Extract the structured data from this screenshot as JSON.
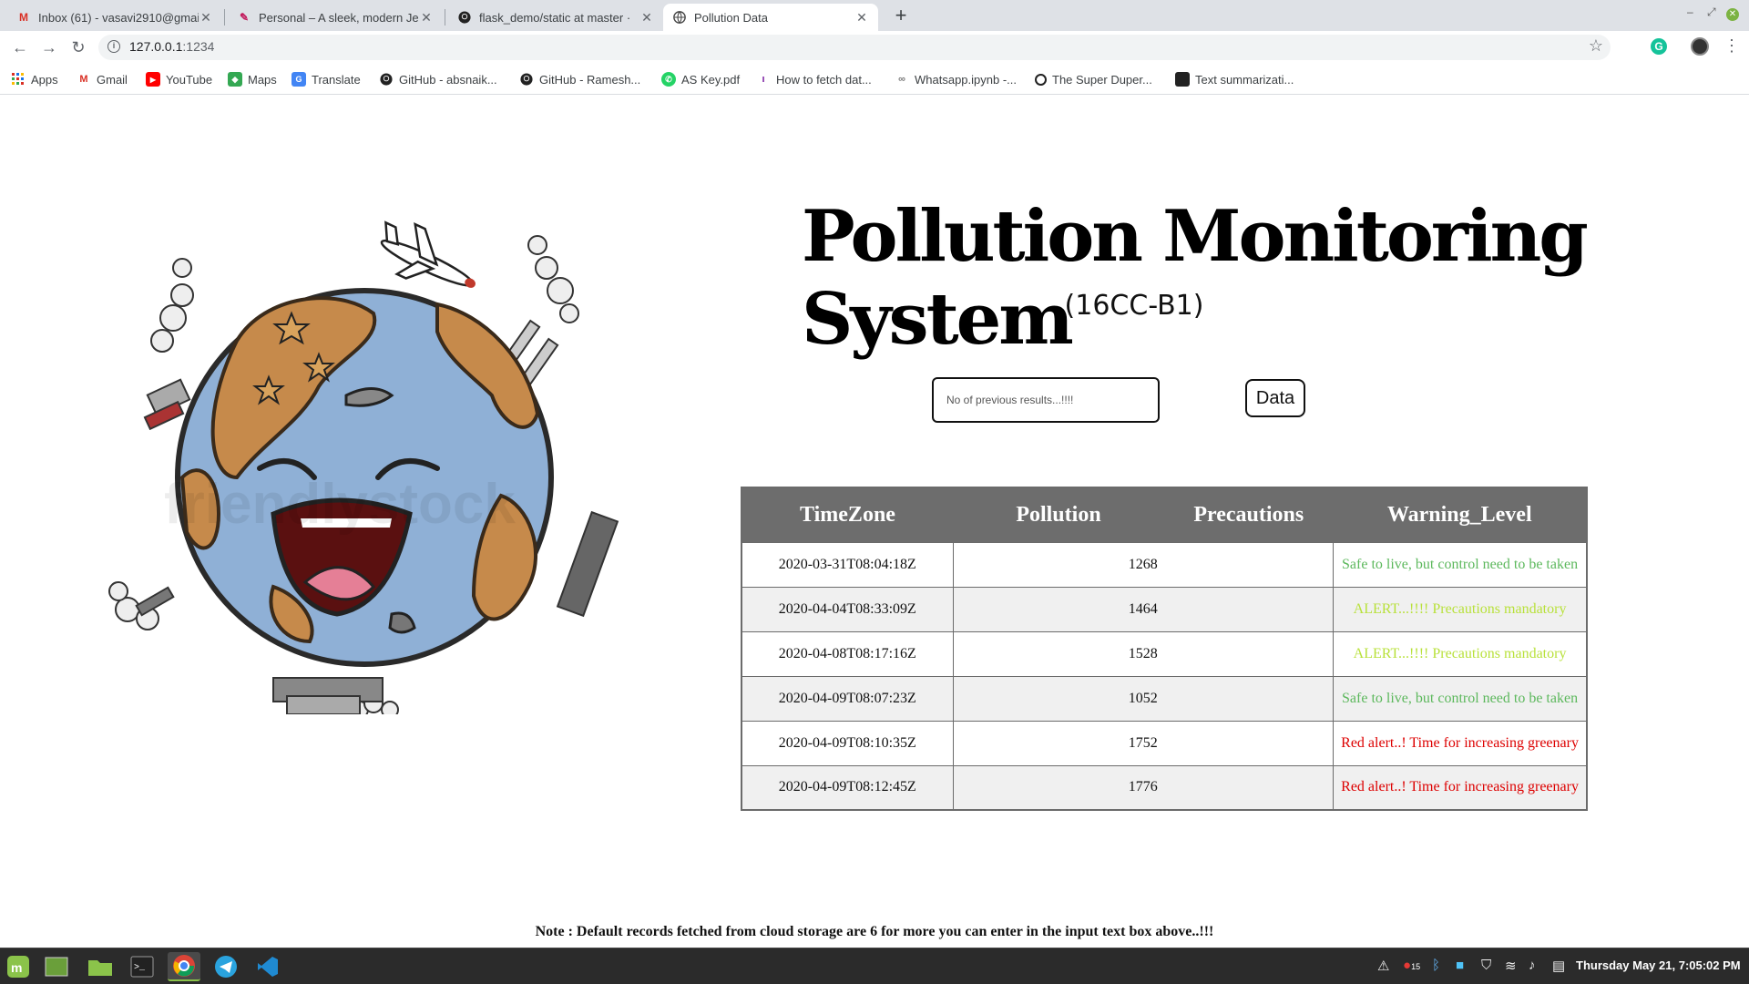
{
  "browser": {
    "tabs": [
      {
        "label": "Inbox (61) - vasavi2910@gmai",
        "icon": "gmail-icon"
      },
      {
        "label": "Personal – A sleek, modern Je",
        "icon": "jekyll-icon"
      },
      {
        "label": "flask_demo/static at master ·",
        "icon": "github-icon"
      },
      {
        "label": "Pollution Data",
        "icon": "globe-icon"
      }
    ],
    "new_tab": "+",
    "url_host": "127.0.0.1",
    "url_port": ":1234",
    "bookmarks": [
      {
        "label": "Apps",
        "icon": "apps-grid-icon"
      },
      {
        "label": "Gmail",
        "icon": "gmail-icon"
      },
      {
        "label": "YouTube",
        "icon": "youtube-icon"
      },
      {
        "label": "Maps",
        "icon": "maps-icon"
      },
      {
        "label": "Translate",
        "icon": "translate-icon"
      },
      {
        "label": "GitHub - absnaik...",
        "icon": "github-icon"
      },
      {
        "label": "GitHub - Ramesh...",
        "icon": "github-icon"
      },
      {
        "label": "AS Key.pdf",
        "icon": "whatsapp-icon"
      },
      {
        "label": "How to fetch dat...",
        "icon": "bookmark-icon"
      },
      {
        "label": "Whatsapp.ipynb -...",
        "icon": "colab-icon"
      },
      {
        "label": "The Super Duper...",
        "icon": "search-icon"
      },
      {
        "label": "Text summarizati...",
        "icon": "page-icon"
      }
    ]
  },
  "page": {
    "title": "Pollution Monitoring System",
    "subtitle": "(16CC-B1)",
    "input_placeholder": "No of previous results...!!!!",
    "button_label": "Data",
    "table": {
      "headers": [
        "TimeZone",
        "Pollution",
        "Precautions",
        "Warning_Level"
      ],
      "rows": [
        {
          "time": "2020-03-31T08:04:18Z",
          "pollution": "1268",
          "warning": "Safe to live, but control need to be taken",
          "level": "safe"
        },
        {
          "time": "2020-04-04T08:33:09Z",
          "pollution": "1464",
          "warning": "ALERT...!!!! Precautions mandatory",
          "level": "alert"
        },
        {
          "time": "2020-04-08T08:17:16Z",
          "pollution": "1528",
          "warning": "ALERT...!!!! Precautions mandatory",
          "level": "alert"
        },
        {
          "time": "2020-04-09T08:07:23Z",
          "pollution": "1052",
          "warning": "Safe to live, but control need to be taken",
          "level": "safe"
        },
        {
          "time": "2020-04-09T08:10:35Z",
          "pollution": "1752",
          "warning": "Red alert..! Time for increasing greenary",
          "level": "red"
        },
        {
          "time": "2020-04-09T08:12:45Z",
          "pollution": "1776",
          "warning": "Red alert..! Time for increasing greenary",
          "level": "red"
        }
      ]
    },
    "note": "Note : Default records fetched from cloud storage are 6 for more you can enter in the input text box above..!!!",
    "watermark": "friendlystock"
  },
  "taskbar": {
    "clock": "Thursday May 21, 7:05:02 PM",
    "badge": "15"
  },
  "colors": {
    "safe": "#5cb85c",
    "alert": "#b8e13a",
    "red": "#dd0000",
    "table_header": "#6d6d6d"
  }
}
